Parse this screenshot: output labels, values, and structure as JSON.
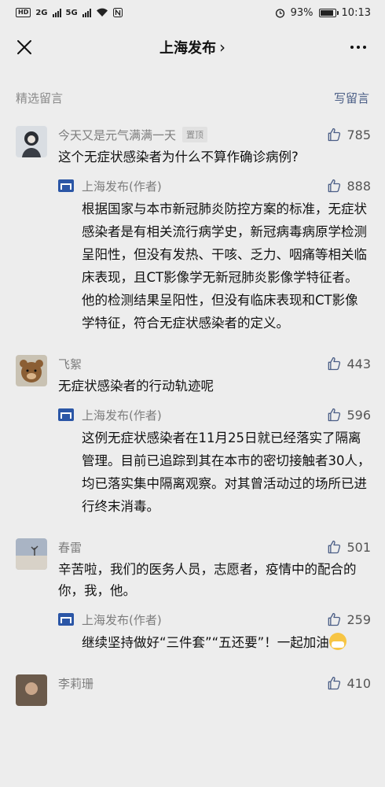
{
  "status_bar": {
    "left_indicators": [
      "HD",
      "2G",
      "5G"
    ],
    "battery": "93%",
    "time": "10:13"
  },
  "nav": {
    "title": "上海发布",
    "title_chevron": "›",
    "left_icon": "close-icon",
    "right_icon": "more-icon"
  },
  "section": {
    "label": "精选留言",
    "write_label": "写留言"
  },
  "comments": [
    {
      "name": "今天又是元气满满一天",
      "pinned_label": "置顶",
      "likes": "785",
      "text": "这个无症状感染者为什么不算作确诊病例?",
      "reply": {
        "author": "上海发布(作者)",
        "likes": "888",
        "text": "根据国家与本市新冠肺炎防控方案的标准，无症状感染者是有相关流行病学史，新冠病毒病原学检测呈阳性，但没有发热、干咳、乏力、咽痛等相关临床表现，且CT影像学无新冠肺炎影像学特征者。他的检测结果呈阳性，但没有临床表现和CT影像学特征，符合无症状感染者的定义。"
      }
    },
    {
      "name": "飞絮",
      "likes": "443",
      "text": "无症状感染者的行动轨迹呢",
      "reply": {
        "author": "上海发布(作者)",
        "likes": "596",
        "text": "这例无症状感染者在11月25日就已经落实了隔离管理。目前已追踪到其在本市的密切接触者30人，均已落实集中隔离观察。对其曾活动过的场所已进行终末消毒。"
      }
    },
    {
      "name": "春雷",
      "likes": "501",
      "text": "辛苦啦，我们的医务人员，志愿者，疫情中的配合的你，我，他。",
      "reply": {
        "author": "上海发布(作者)",
        "likes": "259",
        "text": "继续坚持做好“三件套”“五还要”！一起加油"
      }
    },
    {
      "name": "李莉珊",
      "likes": "410"
    }
  ],
  "colors": {
    "background": "#ededed",
    "link": "#4b5e86",
    "meta": "#7d7d7d",
    "author_logo": "#2b56a6"
  }
}
